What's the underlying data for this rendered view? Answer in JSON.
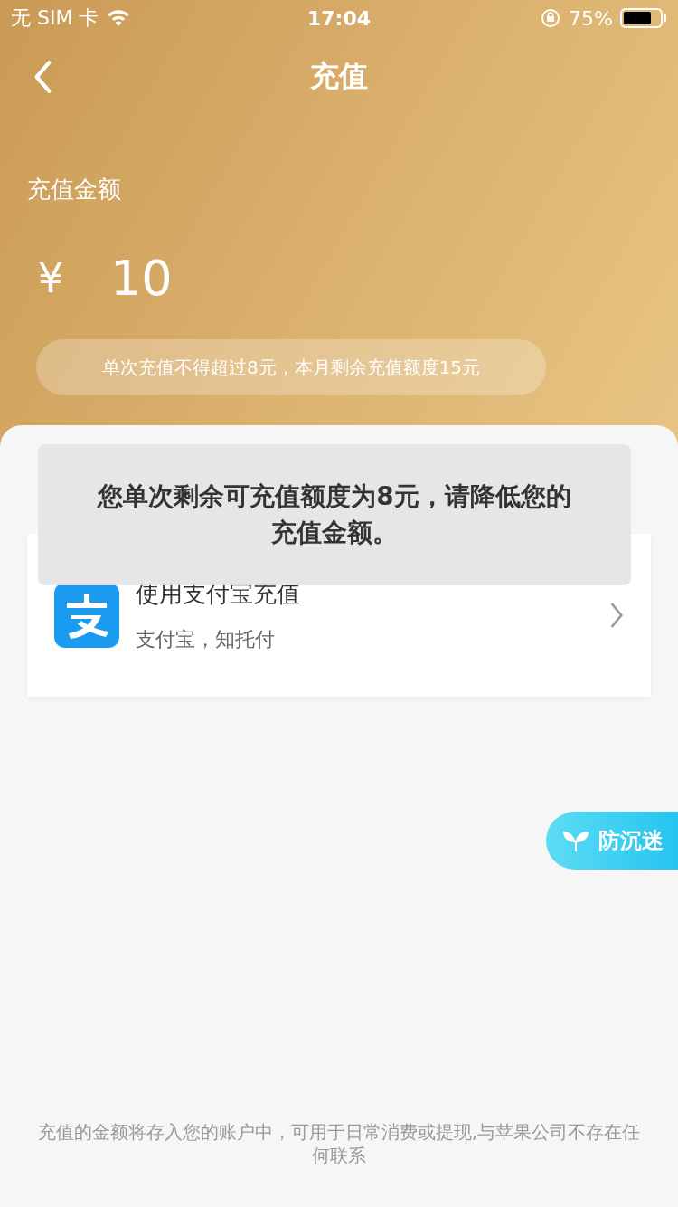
{
  "status_bar": {
    "carrier": "无 SIM 卡",
    "time": "17:04",
    "battery": "75%"
  },
  "nav": {
    "title": "充值"
  },
  "amount": {
    "label": "充值金额",
    "currency": "¥",
    "value": "10",
    "hint": "单次充值不得超过8元，本月剩余充值额度15元"
  },
  "payment": {
    "title": "使用支付宝充值",
    "subtitle": "支付宝，知托付"
  },
  "toast": {
    "message": "您单次剩余可充值额度为8元，请降低您的充值金额。"
  },
  "anti_addiction": {
    "label": "防沉迷"
  },
  "footer": {
    "note": "充值的金额将存入您的账户中，可用于日常消费或提现,与苹果公司不存在任何联系"
  }
}
